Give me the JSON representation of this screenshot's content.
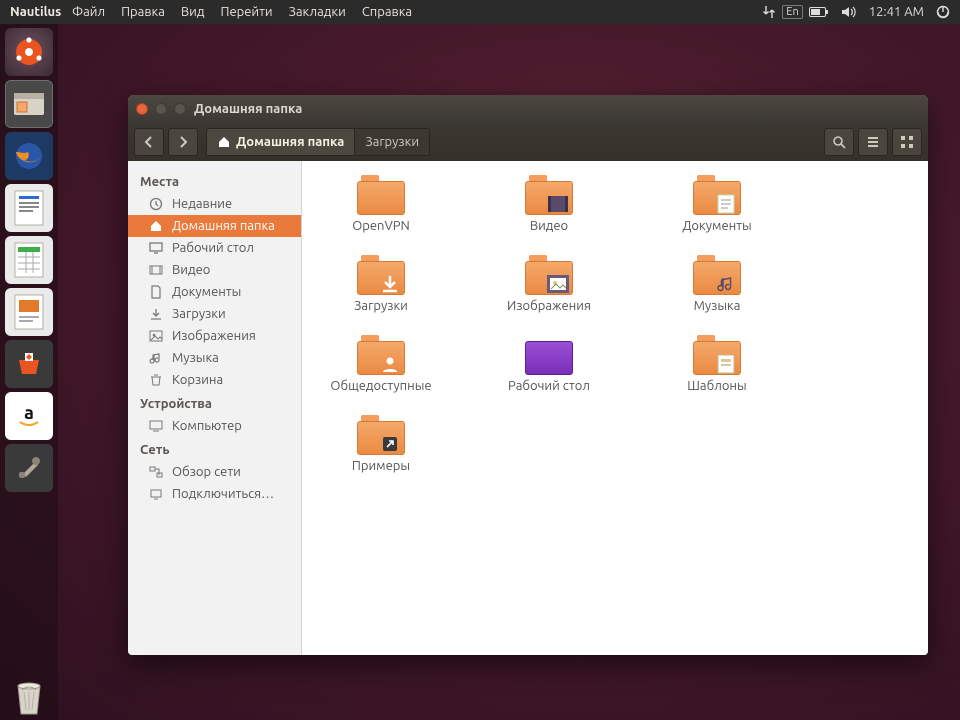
{
  "menubar": {
    "app_name": "Nautilus",
    "items": [
      "Файл",
      "Правка",
      "Вид",
      "Перейти",
      "Закладки",
      "Справка"
    ],
    "indicators": {
      "lang": "En",
      "clock": "12:41 AM"
    }
  },
  "launcher": {
    "items": [
      {
        "name": "dash",
        "tip": "Dash"
      },
      {
        "name": "files",
        "tip": "Files"
      },
      {
        "name": "firefox",
        "tip": "Firefox"
      },
      {
        "name": "writer",
        "tip": "LibreOffice Writer"
      },
      {
        "name": "calc",
        "tip": "LibreOffice Calc"
      },
      {
        "name": "impress",
        "tip": "LibreOffice Impress"
      },
      {
        "name": "software",
        "tip": "Ubuntu Software"
      },
      {
        "name": "amazon",
        "tip": "Amazon"
      },
      {
        "name": "settings",
        "tip": "System Settings"
      }
    ],
    "trash_label": "Trash"
  },
  "window": {
    "title": "Домашняя папка",
    "path": [
      {
        "label": "Домашняя папка",
        "active": true,
        "home": true
      },
      {
        "label": "Загрузки",
        "active": false,
        "home": false
      }
    ],
    "sidebar": {
      "sections": [
        {
          "heading": "Места",
          "items": [
            {
              "label": "Недавние",
              "icon": "clock",
              "selected": false
            },
            {
              "label": "Домашняя папка",
              "icon": "home",
              "selected": true
            },
            {
              "label": "Рабочий стол",
              "icon": "desktop",
              "selected": false
            },
            {
              "label": "Видео",
              "icon": "video",
              "selected": false
            },
            {
              "label": "Документы",
              "icon": "doc",
              "selected": false
            },
            {
              "label": "Загрузки",
              "icon": "download",
              "selected": false
            },
            {
              "label": "Изображения",
              "icon": "image",
              "selected": false
            },
            {
              "label": "Музыка",
              "icon": "music",
              "selected": false
            },
            {
              "label": "Корзина",
              "icon": "trash",
              "selected": false
            }
          ]
        },
        {
          "heading": "Устройства",
          "items": [
            {
              "label": "Компьютер",
              "icon": "computer",
              "selected": false
            }
          ]
        },
        {
          "heading": "Сеть",
          "items": [
            {
              "label": "Обзор сети",
              "icon": "network",
              "selected": false
            },
            {
              "label": "Подключиться…",
              "icon": "connect",
              "selected": false
            }
          ]
        }
      ]
    },
    "files": [
      {
        "label": "OpenVPN",
        "type": "folder",
        "overlay": ""
      },
      {
        "label": "Видео",
        "type": "folder",
        "overlay": "video"
      },
      {
        "label": "Документы",
        "type": "folder",
        "overlay": "doc"
      },
      {
        "label": "Загрузки",
        "type": "folder",
        "overlay": "download"
      },
      {
        "label": "Изображения",
        "type": "folder",
        "overlay": "image"
      },
      {
        "label": "Музыка",
        "type": "folder",
        "overlay": "music"
      },
      {
        "label": "Общедоступные",
        "type": "folder",
        "overlay": "public"
      },
      {
        "label": "Рабочий стол",
        "type": "desktop",
        "overlay": ""
      },
      {
        "label": "Шаблоны",
        "type": "folder",
        "overlay": "template"
      },
      {
        "label": "Примеры",
        "type": "folder",
        "overlay": "link"
      }
    ]
  },
  "colors": {
    "accent": "#ea7a3c"
  }
}
